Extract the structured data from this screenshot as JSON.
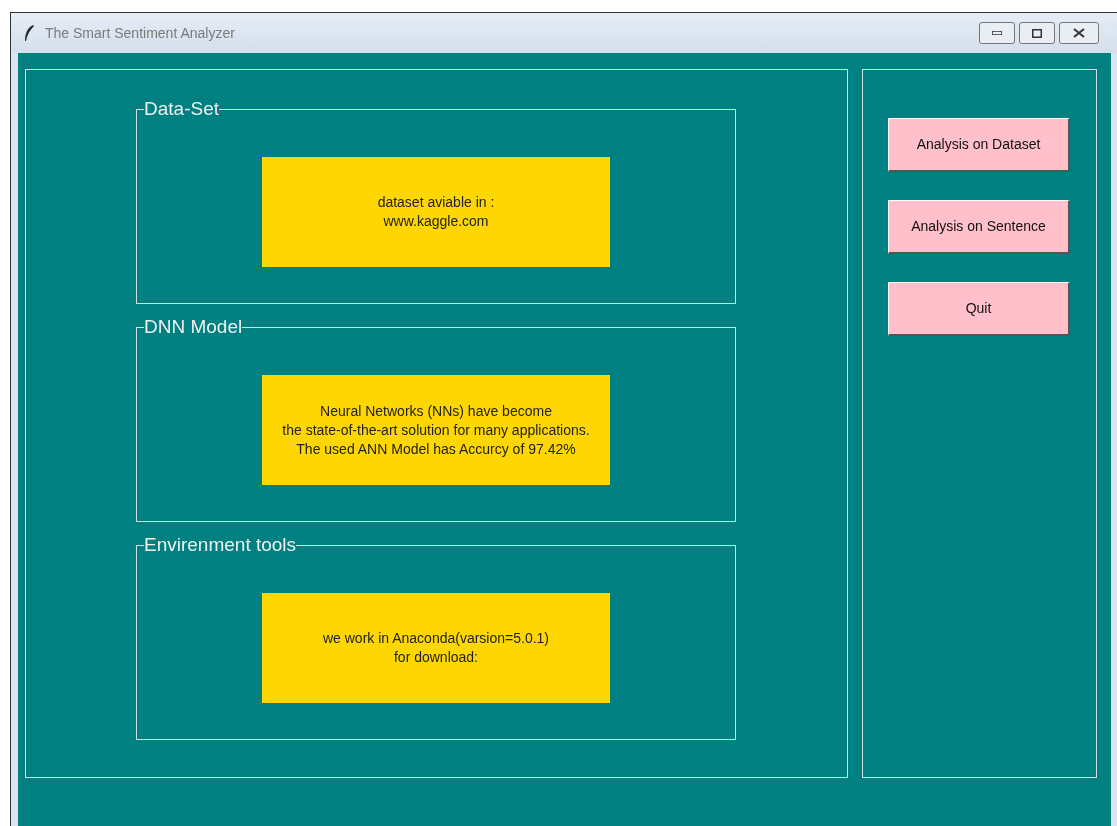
{
  "window": {
    "title": "The Smart Sentiment Analyzer"
  },
  "groups": [
    {
      "title": "Data-Set",
      "lines": [
        "dataset aviable in :",
        "www.kaggle.com"
      ]
    },
    {
      "title": "DNN Model",
      "lines": [
        "Neural Networks (NNs) have become",
        "the state-of-the-art solution for many applications.",
        "The used ANN Model has Accurcy of 97.42%"
      ]
    },
    {
      "title": "Envirenment tools",
      "lines": [
        "we work in Anaconda(varsion=5.0.1)",
        "for download:"
      ]
    }
  ],
  "buttons": [
    "Analysis on Dataset",
    "Analysis on Sentence",
    "Quit"
  ]
}
